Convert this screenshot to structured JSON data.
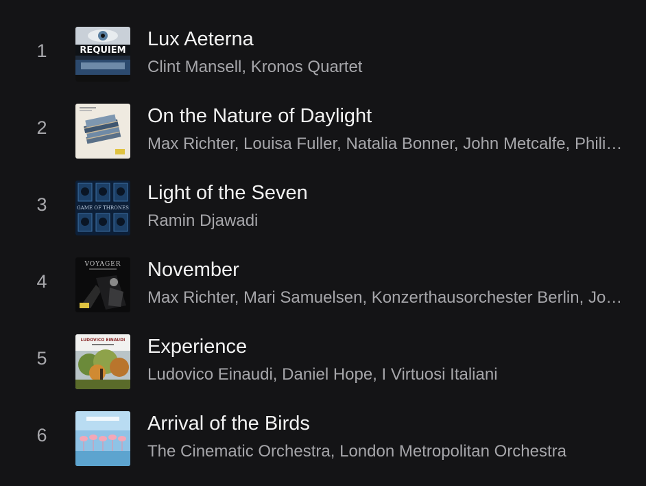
{
  "colors": {
    "background": "#141416",
    "title_text": "#f2f2f2",
    "secondary_text": "#a6a6aa"
  },
  "tracks": [
    {
      "number": "1",
      "title": "Lux Aeterna",
      "artists": "Clint Mansell, Kronos Quartet",
      "cover_icon": "requiem-album-art",
      "cover_text": "REQUIEM"
    },
    {
      "number": "2",
      "title": "On the Nature of Daylight",
      "artists": "Max Richter, Louisa Fuller, Natalia Bonner, John Metcalfe, Philip Sheppard, Chris Worsey",
      "cover_icon": "blue-notebook-album-art"
    },
    {
      "number": "3",
      "title": "Light of the Seven",
      "artists": "Ramin Djawadi",
      "cover_icon": "game-of-thrones-album-art",
      "cover_text": "GAME OF THRONES"
    },
    {
      "number": "4",
      "title": "November",
      "artists": "Max Richter, Mari Samuelsen, Konzerthausorchester Berlin, Jonathan Stockhammer",
      "cover_icon": "voyager-album-art",
      "cover_text": "VOYAGER"
    },
    {
      "number": "5",
      "title": "Experience",
      "artists": "Ludovico Einaudi, Daniel Hope, I Virtuosi Italiani",
      "cover_icon": "ludovico-einaudi-album-art",
      "cover_text": "LUDOVICO EINAUDI"
    },
    {
      "number": "6",
      "title": "Arrival of the Birds",
      "artists": "The Cinematic Orchestra, London Metropolitan Orchestra",
      "cover_icon": "flamingos-album-art"
    }
  ]
}
